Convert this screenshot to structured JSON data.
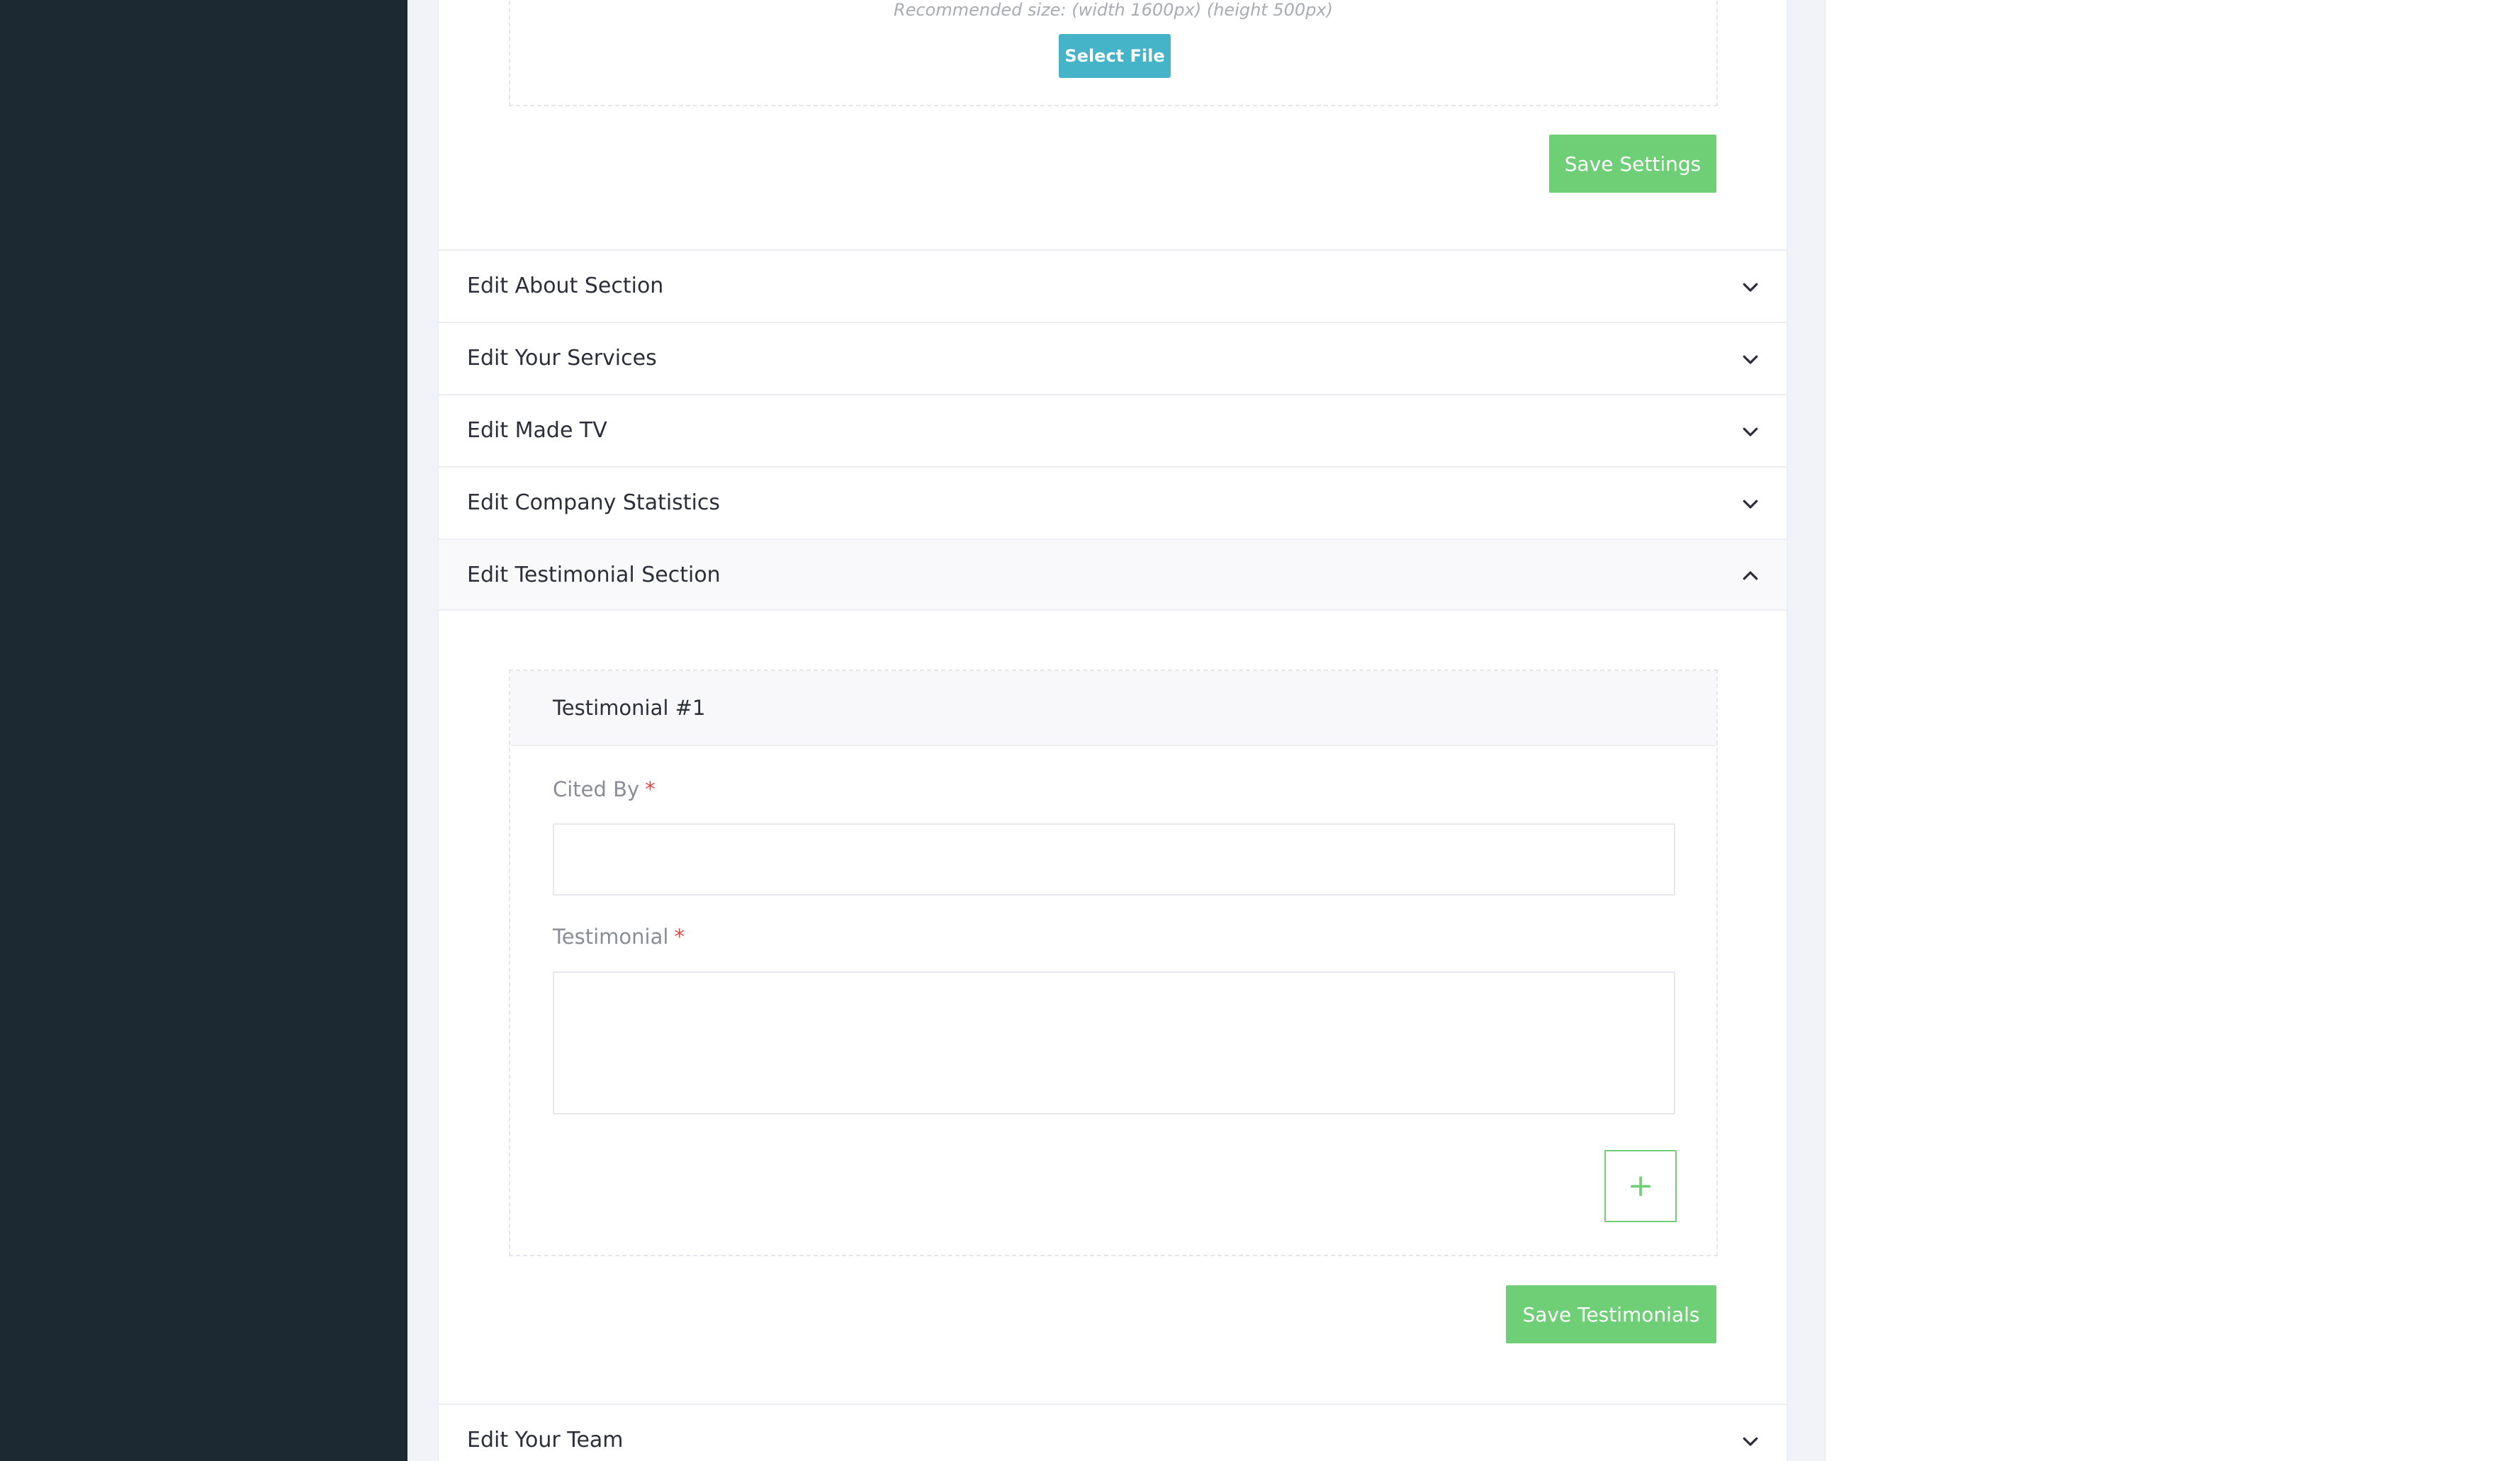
{
  "upload": {
    "recommended_size": "Recommended size: (width 1600px) (height 500px)",
    "select_file_label": "Select File"
  },
  "save_settings_label": "Save Settings",
  "sections": [
    {
      "title": "Edit About Section",
      "expanded": false,
      "icon": "chevron-down-icon"
    },
    {
      "title": "Edit Your Services",
      "expanded": false,
      "icon": "chevron-down-icon"
    },
    {
      "title": "Edit Made TV",
      "expanded": false,
      "icon": "chevron-down-icon"
    },
    {
      "title": "Edit Company Statistics",
      "expanded": false,
      "icon": "chevron-down-icon"
    },
    {
      "title": "Edit Testimonial Section",
      "expanded": true,
      "icon": "chevron-up-icon"
    },
    {
      "title": "Edit Your Team",
      "expanded": false,
      "icon": "chevron-down-icon"
    }
  ],
  "testimonial": {
    "title": "Testimonial #1",
    "cited_by_label": "Cited By",
    "cited_by_value": "",
    "testimonial_label": "Testimonial",
    "testimonial_value": "",
    "required_mark": "*",
    "add_symbol": "+",
    "add_icon": "plus-icon",
    "save_label": "Save Testimonials"
  },
  "colors": {
    "sidebar": "#1c2832",
    "accent_green": "#6ecf77",
    "accent_blue": "#45b3c8",
    "required": "#e04a4a"
  }
}
